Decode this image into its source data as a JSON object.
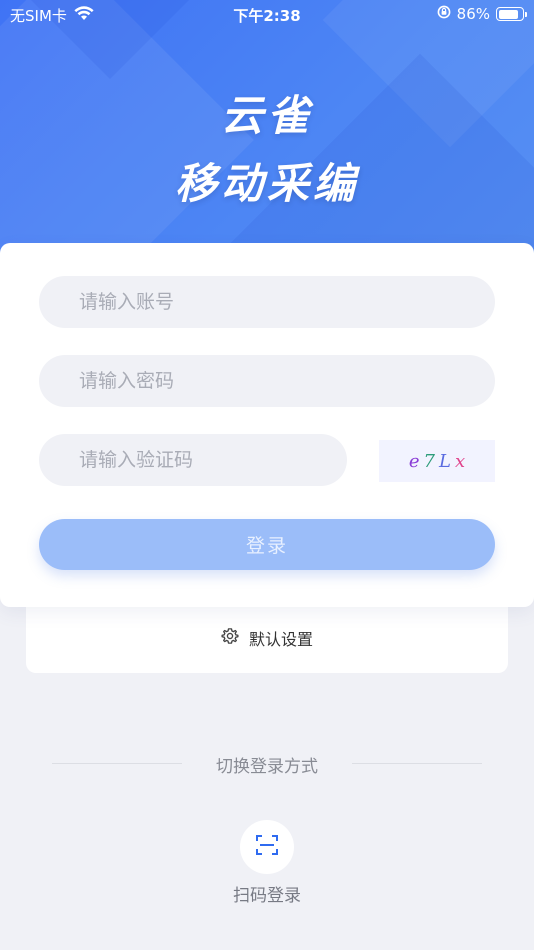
{
  "status_bar": {
    "carrier": "无SIM卡",
    "time": "下午2:38",
    "battery": "86%",
    "battery_level": 0.86
  },
  "hero": {
    "title_line1": "云雀",
    "title_line2": "移动采编"
  },
  "login_form": {
    "account_placeholder": "请输入账号",
    "password_placeholder": "请输入密码",
    "captcha_placeholder": "请输入验证码",
    "captcha_chars": [
      "e",
      "7",
      "L",
      "x"
    ],
    "login_label": "登录"
  },
  "settings": {
    "label": "默认设置"
  },
  "switch_login": {
    "divider_label": "切换登录方式",
    "scan_label": "扫码登录"
  },
  "colors": {
    "primary": "#4d86f4",
    "login_button_disabled": "#9bbdf9",
    "page_background": "#f0f1f6"
  },
  "icons": {
    "wifi": "wifi-icon",
    "rotation_lock": "rotation-lock-icon",
    "battery": "battery-icon",
    "settings": "gear-icon",
    "scan": "scan-icon"
  }
}
